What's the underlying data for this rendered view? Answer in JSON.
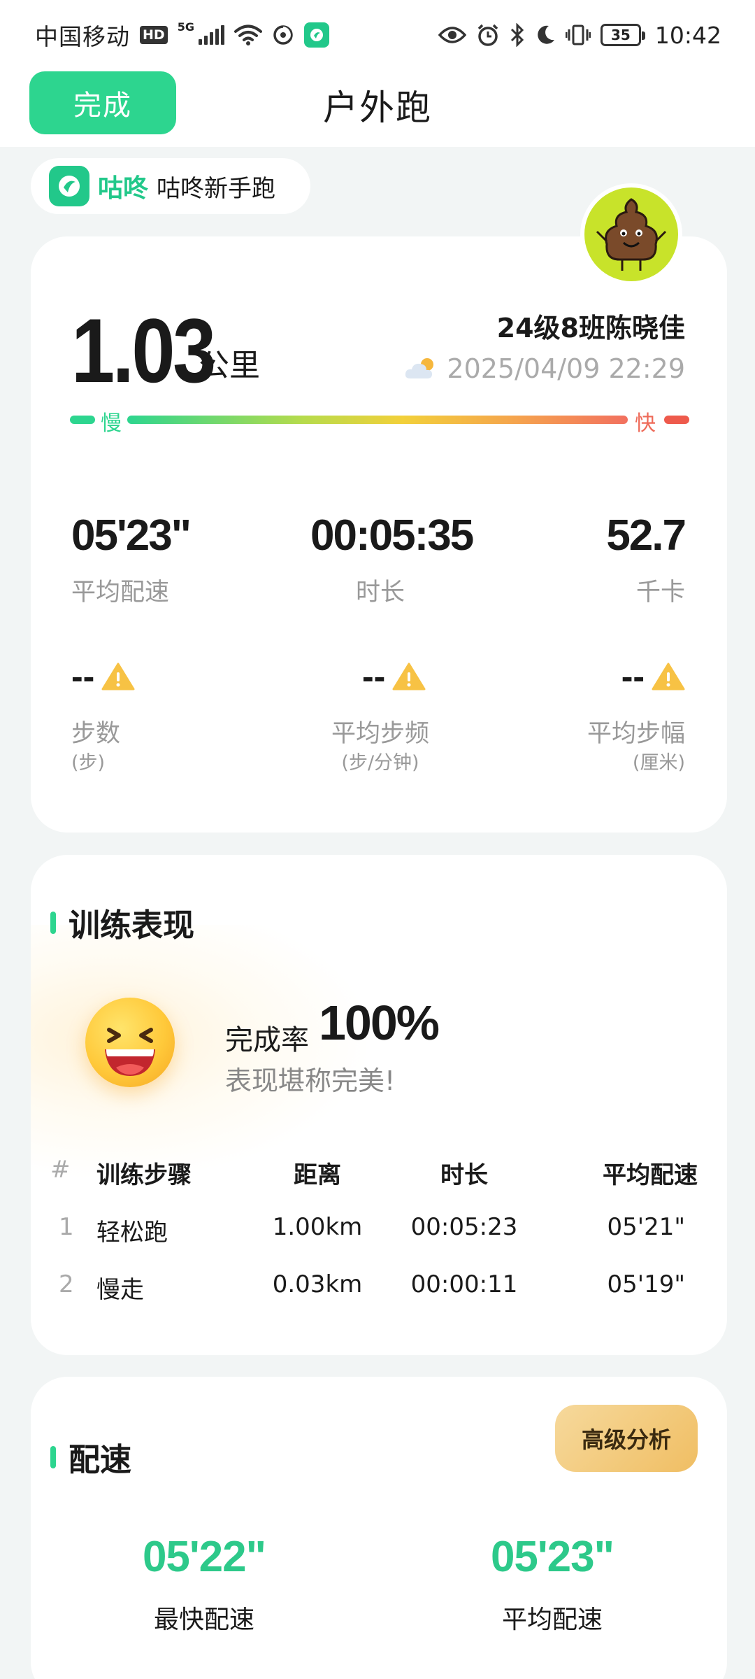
{
  "status_bar": {
    "carrier": "中国移动",
    "hd": "HD",
    "network": "5G",
    "battery": "35",
    "time": "10:42"
  },
  "header": {
    "done_label": "完成",
    "title": "户外跑"
  },
  "brand": {
    "name": "咕咚",
    "subtitle": "咕咚新手跑"
  },
  "summary": {
    "distance": "1.03",
    "distance_unit": "公里",
    "user_name": "24级8班陈晓佳",
    "date": "2025/04/09 22:29",
    "slow_label": "慢",
    "fast_label": "快",
    "stats": [
      {
        "value": "05'23\"",
        "label": "平均配速"
      },
      {
        "value": "00:05:35",
        "label": "时长"
      },
      {
        "value": "52.7",
        "label": "千卡"
      }
    ],
    "step_stats": [
      {
        "value": "--",
        "label": "步数",
        "unit": "(步)"
      },
      {
        "value": "--",
        "label": "平均步频",
        "unit": "(步/分钟)"
      },
      {
        "value": "--",
        "label": "平均步幅",
        "unit": "(厘米)"
      }
    ]
  },
  "training": {
    "title": "训练表现",
    "completion_label": "完成率",
    "completion_value": "100%",
    "completion_comment": "表现堪称完美!",
    "table": {
      "headers": [
        "#",
        "训练步骤",
        "距离",
        "时长",
        "平均配速"
      ],
      "rows": [
        [
          "1",
          "轻松跑",
          "1.00km",
          "00:05:23",
          "05'21\""
        ],
        [
          "2",
          "慢走",
          "0.03km",
          "00:00:11",
          "05'19\""
        ]
      ]
    }
  },
  "pace": {
    "title": "配速",
    "advanced_label": "高级分析",
    "fastest_value": "05'22\"",
    "fastest_label": "最快配速",
    "average_value": "05'23\"",
    "average_label": "平均配速"
  },
  "colors": {
    "accent_green": "#2DD58F",
    "pace_green": "#2DC98A",
    "fast_red": "#EE5A4C",
    "gold_button": "#F0BE63"
  }
}
